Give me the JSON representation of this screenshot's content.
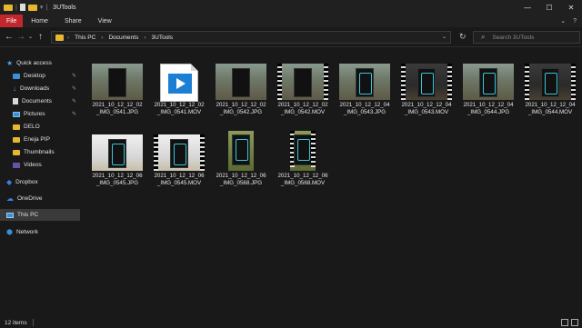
{
  "window": {
    "title": "3UTools",
    "controls": {
      "minimize": "—",
      "maximize": "☐",
      "close": "✕"
    }
  },
  "ribbon": {
    "tabs": [
      "File",
      "Home",
      "Share",
      "View"
    ],
    "right_icons": [
      "chevron-down-icon",
      "help-icon"
    ]
  },
  "address": {
    "breadcrumbs": [
      "This PC",
      "Documents",
      "3UTools"
    ],
    "search_placeholder": "Search 3UTools"
  },
  "sidebar": {
    "items": [
      {
        "label": "Quick access",
        "icon": "star-icon",
        "pinned": false
      },
      {
        "label": "Desktop",
        "icon": "desktop-folder-icon",
        "pinned": true
      },
      {
        "label": "Downloads",
        "icon": "downloads-icon",
        "pinned": true
      },
      {
        "label": "Documents",
        "icon": "documents-icon",
        "pinned": true
      },
      {
        "label": "Pictures",
        "icon": "pictures-icon",
        "pinned": true
      },
      {
        "label": "DELO",
        "icon": "folder-icon",
        "pinned": false
      },
      {
        "label": "Eneja PIP",
        "icon": "folder-icon",
        "pinned": false
      },
      {
        "label": "Thumbnails",
        "icon": "folder-icon",
        "pinned": false
      },
      {
        "label": "Videos",
        "icon": "videos-icon",
        "pinned": false
      },
      {
        "label": "Dropbox",
        "icon": "dropbox-icon",
        "pinned": false
      },
      {
        "label": "OneDrive",
        "icon": "onedrive-icon",
        "pinned": false
      },
      {
        "label": "This PC",
        "icon": "this-pc-icon",
        "pinned": false,
        "selected": true
      },
      {
        "label": "Network",
        "icon": "network-icon",
        "pinned": false
      }
    ]
  },
  "files": [
    {
      "line1": "2021_10_12_12_02",
      "line2": "_IMG_0541.JPG",
      "kind": "photo"
    },
    {
      "line1": "2021_10_12_12_02",
      "line2": "_IMG_0541.MOV",
      "kind": "movie-generic"
    },
    {
      "line1": "2021_10_12_12_02",
      "line2": "_IMG_0542.JPG",
      "kind": "photo"
    },
    {
      "line1": "2021_10_12_12_02",
      "line2": "_IMG_0542.MOV",
      "kind": "video"
    },
    {
      "line1": "2021_10_12_12_04",
      "line2": "_IMG_0543.JPG",
      "kind": "photo"
    },
    {
      "line1": "2021_10_12_12_04",
      "line2": "_IMG_0543.MOV",
      "kind": "video"
    },
    {
      "line1": "2021_10_12_12_04",
      "line2": "_IMG_0544.JPG",
      "kind": "photo"
    },
    {
      "line1": "2021_10_12_12_04",
      "line2": "_IMG_0544.MOV",
      "kind": "video"
    },
    {
      "line1": "2021_10_12_12_06",
      "line2": "_IMG_0545.JPG",
      "kind": "photo-light"
    },
    {
      "line1": "2021_10_12_12_06",
      "line2": "_IMG_0545.MOV",
      "kind": "video-light"
    },
    {
      "line1": "2021_10_12_12_06",
      "line2": "_IMG_0568.JPG",
      "kind": "photo-tall"
    },
    {
      "line1": "2021_10_12_12_06",
      "line2": "_IMG_0568.MOV",
      "kind": "video-tall"
    }
  ],
  "status": {
    "item_count": "12 items"
  },
  "colors": {
    "file_tab": "#c1272d",
    "folder": "#e8b62f",
    "accent": "#3b8fd6"
  }
}
